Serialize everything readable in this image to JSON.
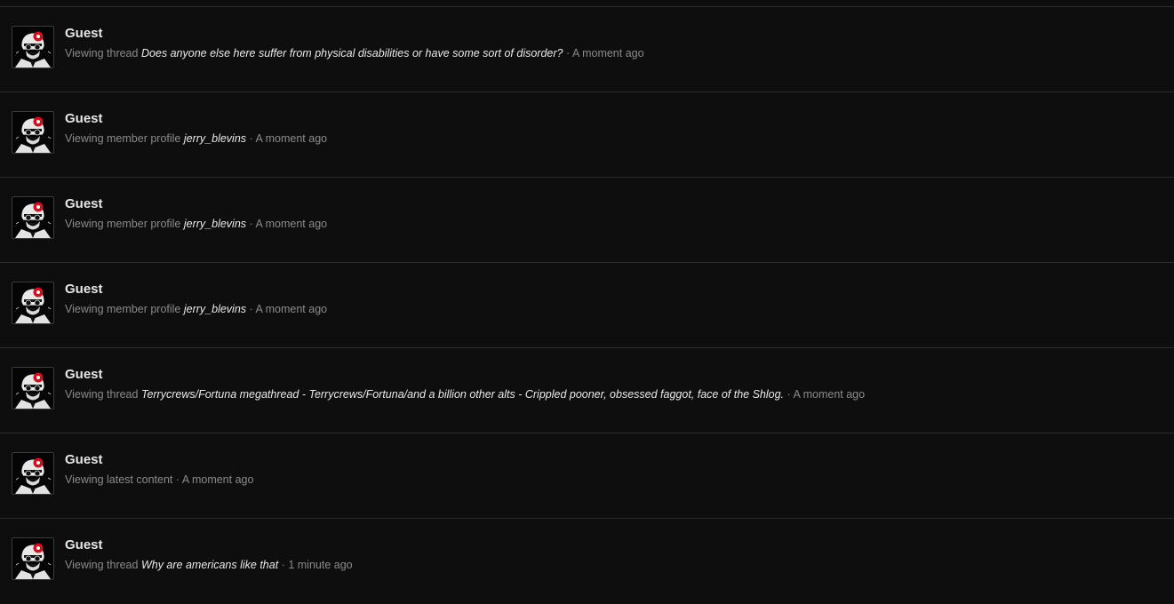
{
  "rows": [
    {
      "user": "Guest",
      "action": "Viewing thread",
      "target": "Does anyone else here suffer from physical disabilities or have some sort of disorder?",
      "separator": "·",
      "time": "A moment ago"
    },
    {
      "user": "Guest",
      "action": "Viewing member profile",
      "target": "jerry_blevins",
      "separator": "·",
      "time": "A moment ago"
    },
    {
      "user": "Guest",
      "action": "Viewing member profile",
      "target": "jerry_blevins",
      "separator": "·",
      "time": "A moment ago"
    },
    {
      "user": "Guest",
      "action": "Viewing member profile",
      "target": "jerry_blevins",
      "separator": "·",
      "time": "A moment ago"
    },
    {
      "user": "Guest",
      "action": "Viewing thread",
      "target": "Terrycrews/Fortuna megathread - Terrycrews/Fortuna/and a billion other alts - Crippled pooner, obsessed faggot, face of the Shlog.",
      "separator": "·",
      "time": "A moment ago"
    },
    {
      "user": "Guest",
      "action": "Viewing latest content",
      "target": "",
      "separator": "·",
      "time": "A moment ago"
    },
    {
      "user": "Guest",
      "action": "Viewing thread",
      "target": "Why are americans like that",
      "separator": "·",
      "time": "1 minute ago"
    }
  ],
  "colors": {
    "background": "#0e0e0f",
    "divider": "#2b2b2d",
    "username": "#e6e6e6",
    "muted_text": "#8a8a8a",
    "link_text": "#e9e9e9",
    "avatar_accent": "#d0101a"
  },
  "icons": {
    "avatar": "default-guest-avatar-icon"
  }
}
